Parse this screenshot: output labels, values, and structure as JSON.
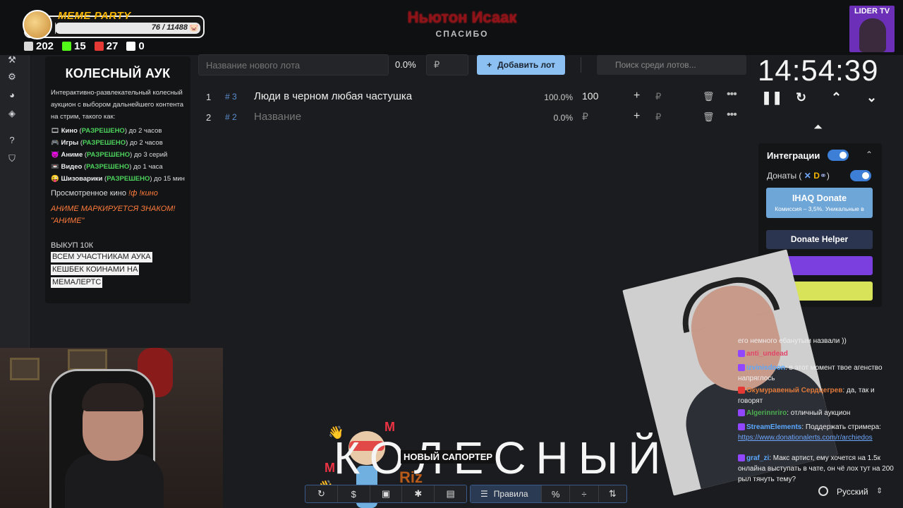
{
  "overlay": {
    "meme_title": "MEME PARTY",
    "meme_count": "76 / 11488",
    "meme_progress": 0.0066,
    "stats": [
      {
        "value": "202",
        "icon": "heart-icon",
        "color": "#d9d9d9"
      },
      {
        "value": "15",
        "icon": "kick-icon",
        "color": "#53fc18"
      },
      {
        "value": "27",
        "icon": "live-icon",
        "color": "#e53935"
      },
      {
        "value": "0",
        "icon": "w-icon",
        "color": "#ffffff"
      }
    ],
    "streamer_name": "Ньютон Исаак",
    "streamer_thanks": "СПАСИБО",
    "lider_label": "LIDER TV"
  },
  "info": {
    "title": "КОЛЕСНЫЙ АУК",
    "description": "Интерактивно-развлекательный колесный аукцион с выбором дальнейшего контента на стрим, такого как:",
    "items": [
      {
        "icon": "🎞",
        "name": "Кино",
        "status": "РАЗРЕШЕНО",
        "limit": "до 2 часов"
      },
      {
        "icon": "🎮",
        "name": "Игры",
        "status": "РАЗРЕШЕНО",
        "limit": "до 2 часов"
      },
      {
        "icon": "😈",
        "name": "Аниме",
        "status": "РАЗРЕШЕНО",
        "limit": "до 3 серий"
      },
      {
        "icon": "📼",
        "name": "Видео",
        "status": "РАЗРЕШЕНО",
        "limit": "до 1 часа"
      },
      {
        "icon": "😜",
        "name": "Шизоварики",
        "status": "РАЗРЕШЕНО",
        "limit": "до 15 мин"
      }
    ],
    "watched_label": "Просмотренное кино",
    "watched_cmd": "!ф !кино",
    "anime_note": "АНИМЕ МАРКИРУЕТСЯ ЗНАКОМ! \"АНИМЕ\"",
    "buyout": "ВЫКУП 10К",
    "cashback": [
      "ВСЕМ УЧАСТНИКАМ АУКА",
      "КЕШБЕК КОИНАМИ НА",
      "МЕМАЛЕРТС"
    ]
  },
  "lot_form": {
    "name_placeholder": "Название нового лота",
    "percent": "0.0%",
    "amount_placeholder": "₽",
    "add_label": "Добавить лот",
    "search_placeholder": "Поиск среди лотов..."
  },
  "lots": [
    {
      "index": "1",
      "id": "3",
      "name": "Люди в черном любая частушка",
      "percent": "100.0%",
      "amount": "100",
      "currency": "₽"
    },
    {
      "index": "2",
      "id": "2",
      "name": "Название",
      "percent": "0.0%",
      "amount": "₽",
      "currency": "₽"
    }
  ],
  "timer": {
    "time": "14:54:39"
  },
  "integrations": {
    "title": "Интеграции",
    "donations_label": "Донаты (",
    "ihaq_title": "IHAQ Donate",
    "ihaq_sub": "Комиссия – 3,5%. Уникальные в",
    "donate_helper": "Donate Helper"
  },
  "chat": [
    {
      "user": "",
      "text": "его немного ебанутым назвали ))",
      "color": "#ffffff"
    },
    {
      "user": "anti_undead",
      "text": "",
      "color": "#e0456a"
    },
    {
      "user": "izvinisdoon",
      "text": ": в этот момент твое агенство напряглось",
      "color": "#5aa8ff"
    },
    {
      "user": "Окумуравеный Сердцегрев",
      "text": ": да, так и говорят",
      "color": "#e07a3a"
    },
    {
      "user": "Algerinnriro",
      "text": ": отличный аукцион",
      "color": "#4caf50"
    },
    {
      "user": "StreamElements",
      "text": ": Поддержать стримера:",
      "color": "#5aa8ff",
      "link": "https://www.donationalerts.com/r/archiedos"
    },
    {
      "user": "graf_zi",
      "text": ": Макс артист, ему хочется на 1.5к онлайна выступать в чате, он чё лох тут на 200 рыл тянуть тему?",
      "color": "#5aa8ff"
    }
  ],
  "language": "Русский",
  "bottom": {
    "big_word": "КОЛЕСНЫЙ",
    "supporter": "НОВЫЙ САПОРТЕР",
    "riz": "Riz",
    "rules_label": "Правила"
  }
}
